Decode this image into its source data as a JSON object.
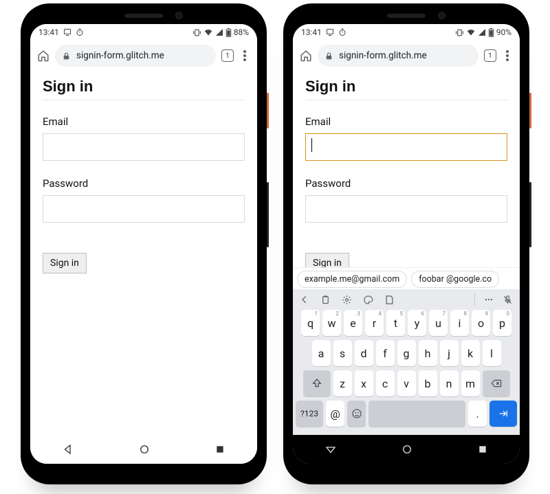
{
  "phones": {
    "left": {
      "status": {
        "time": "13:41",
        "battery": "88%"
      },
      "chrome": {
        "url": "signin-form.glitch.me",
        "tabcount": "1"
      },
      "page": {
        "heading": "Sign in",
        "email_label": "Email",
        "password_label": "Password",
        "submit_label": "Sign in"
      }
    },
    "right": {
      "status": {
        "time": "13:41",
        "battery": "90%"
      },
      "chrome": {
        "url": "signin-form.glitch.me",
        "tabcount": "1"
      },
      "page": {
        "heading": "Sign in",
        "email_label": "Email",
        "password_label": "Password",
        "submit_label": "Sign in"
      },
      "suggestions": [
        "example.me@gmail.com",
        "foobar @google.co"
      ],
      "keyboard": {
        "row1": [
          {
            "k": "q",
            "s": "1"
          },
          {
            "k": "w",
            "s": "2"
          },
          {
            "k": "e",
            "s": "3"
          },
          {
            "k": "r",
            "s": "4"
          },
          {
            "k": "t",
            "s": "5"
          },
          {
            "k": "y",
            "s": "6"
          },
          {
            "k": "u",
            "s": "7"
          },
          {
            "k": "i",
            "s": "8"
          },
          {
            "k": "o",
            "s": "9"
          },
          {
            "k": "p",
            "s": "0"
          }
        ],
        "row2": [
          "a",
          "s",
          "d",
          "f",
          "g",
          "h",
          "j",
          "k",
          "l"
        ],
        "row3": [
          "z",
          "x",
          "c",
          "v",
          "b",
          "n",
          "m"
        ],
        "sym": "?123",
        "at": "@",
        "dot": "."
      }
    }
  }
}
